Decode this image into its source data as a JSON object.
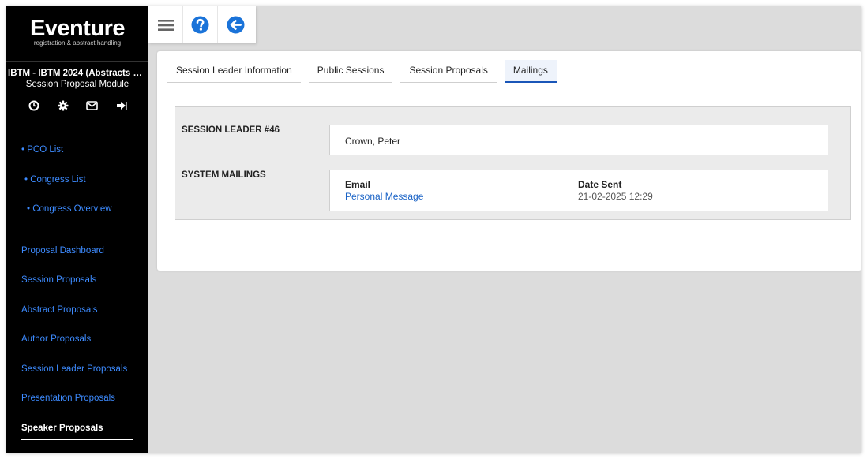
{
  "brand": {
    "name": "Eventure",
    "tagline": "registration & abstract handling"
  },
  "event": {
    "title": "IBTM - IBTM 2024 (Abstracts & Par...",
    "module": "Session Proposal Module"
  },
  "sidebar_icons": [
    "clock-icon",
    "gear-icon",
    "envelope-icon",
    "sign-out-icon"
  ],
  "nav": {
    "pco_list": "• PCO List",
    "congress_list": "• Congress List",
    "congress_overview": "• Congress Overview",
    "proposal_dashboard": "Proposal Dashboard",
    "session_proposals": "Session Proposals",
    "abstract_proposals": "Abstract Proposals",
    "author_proposals": "Author Proposals",
    "session_leader_proposals": "Session Leader Proposals",
    "presentation_proposals": "Presentation Proposals",
    "speaker_proposals": "Speaker Proposals"
  },
  "toolbar_icons": [
    "menu-icon",
    "help-icon",
    "back-arrow-icon"
  ],
  "tabs": {
    "session_leader_information": "Session Leader Information",
    "public_sessions": "Public Sessions",
    "session_proposals": "Session Proposals",
    "mailings": "Mailings"
  },
  "details": {
    "leader_label": "SESSION LEADER #46",
    "leader_name": "Crown, Peter",
    "mailings_label": "SYSTEM MAILINGS",
    "email_header": "Email",
    "email_value": "Personal Message",
    "date_header": "Date Sent",
    "date_value": "21-02-2025 12:29"
  },
  "colors": {
    "sidebar_bg": "#000000",
    "nav_link": "#3d8bff",
    "link": "#1a63c6",
    "accent": "#1a56b8",
    "toolbar_icon": "#1a73d9"
  }
}
